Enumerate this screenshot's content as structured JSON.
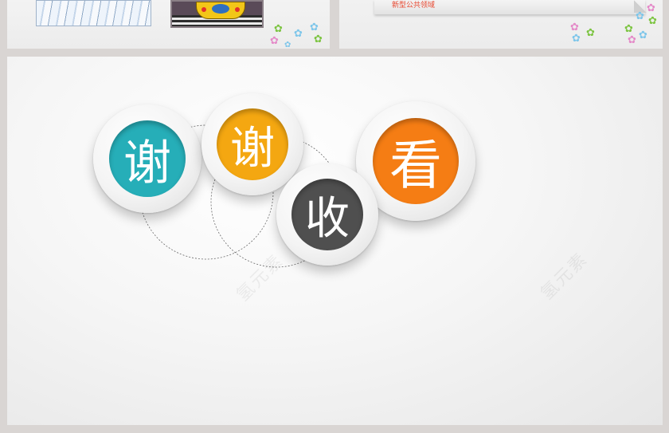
{
  "top_right": {
    "note_text": "新型公共领域"
  },
  "watermarks": [
    "氢元素",
    "氢元素"
  ],
  "closing": {
    "chars": [
      "谢",
      "谢",
      "收",
      "看"
    ],
    "colors": [
      "#26aeb8",
      "#f4a711",
      "#4f4f4f",
      "#f57d14"
    ]
  },
  "colors": {
    "background": "#d9d5d3",
    "flower_pink": "#e48ac8",
    "flower_green": "#7cc441",
    "flower_blue": "#7ec6ea"
  }
}
